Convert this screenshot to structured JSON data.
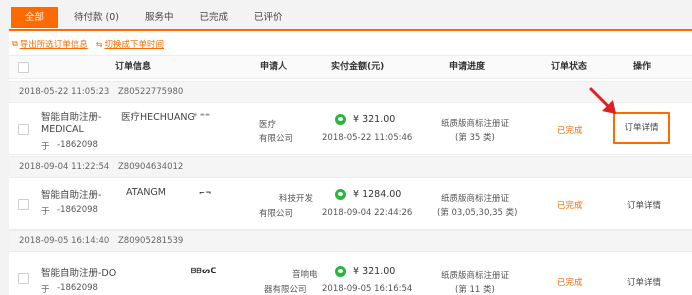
{
  "tabs": [
    {
      "label": "全部",
      "active": true
    },
    {
      "label": "待付款 (0)",
      "active": false
    },
    {
      "label": "服务中",
      "active": false
    },
    {
      "label": "已完成",
      "active": false
    },
    {
      "label": "已评价",
      "active": false
    }
  ],
  "toolbar": {
    "export_label": "导出所选订单信息",
    "switch_label": "切换成下单时间"
  },
  "columns": {
    "order_info": "订单信息",
    "applicant": "申请人",
    "amount": "实付金额(元)",
    "progress": "申请进度",
    "status": "订单状态",
    "action": "操作"
  },
  "orders": [
    {
      "datetime": "2018-05-22 11:05:23",
      "order_no": "Z80522775980",
      "title": "智能自助注册-",
      "title_suffix": "医疗HECHUANG",
      "title_line2": "MEDICAL",
      "sub_prefix": "于",
      "phone": "-1862098",
      "applicant_line1": "医疗",
      "applicant_line2": "有限公司",
      "amount": "¥ 321.00",
      "paid_time": "2018-05-22 11:05:46",
      "progress_line1": "纸质版商标注册证",
      "progress_line2": "(第 35 类)",
      "status": "已完成",
      "action": "订单详情"
    },
    {
      "datetime": "2018-09-04 11:22:54",
      "order_no": "Z80904634012",
      "title": "智能自助注册-",
      "title_suffix": "ATANGM",
      "title_line2": "",
      "sub_prefix": "于",
      "phone": "-1862098",
      "applicant_line1": "科技开发",
      "applicant_line2": "有限公司",
      "amount": "¥ 1284.00",
      "paid_time": "2018-09-04 22:44:26",
      "progress_line1": "纸质版商标注册证",
      "progress_line2": "(第 03,05,30,35 类)",
      "status": "已完成",
      "action": "订单详情"
    },
    {
      "datetime": "2018-09-05 16:14:40",
      "order_no": "Z80905281539",
      "title": "智能自助注册-DO",
      "title_suffix": "",
      "title_line2": "",
      "sub_prefix": "于",
      "phone": "-1862098",
      "applicant_line1": "音响电",
      "applicant_line2": "器有限公司",
      "amount": "¥ 321.00",
      "paid_time": "2018-09-05 16:16:54",
      "progress_line1": "纸质版商标注册证",
      "progress_line2": "(第 11 类)",
      "status": "已完成",
      "action": "订单详情"
    }
  ],
  "colors": {
    "accent": "#ff6a00",
    "wechat": "#27b640",
    "arrow": "#e02020"
  },
  "icons": [
    "export-icon",
    "switch-icon",
    "wechat-pay-icon",
    "arrow-annotation-icon"
  ]
}
